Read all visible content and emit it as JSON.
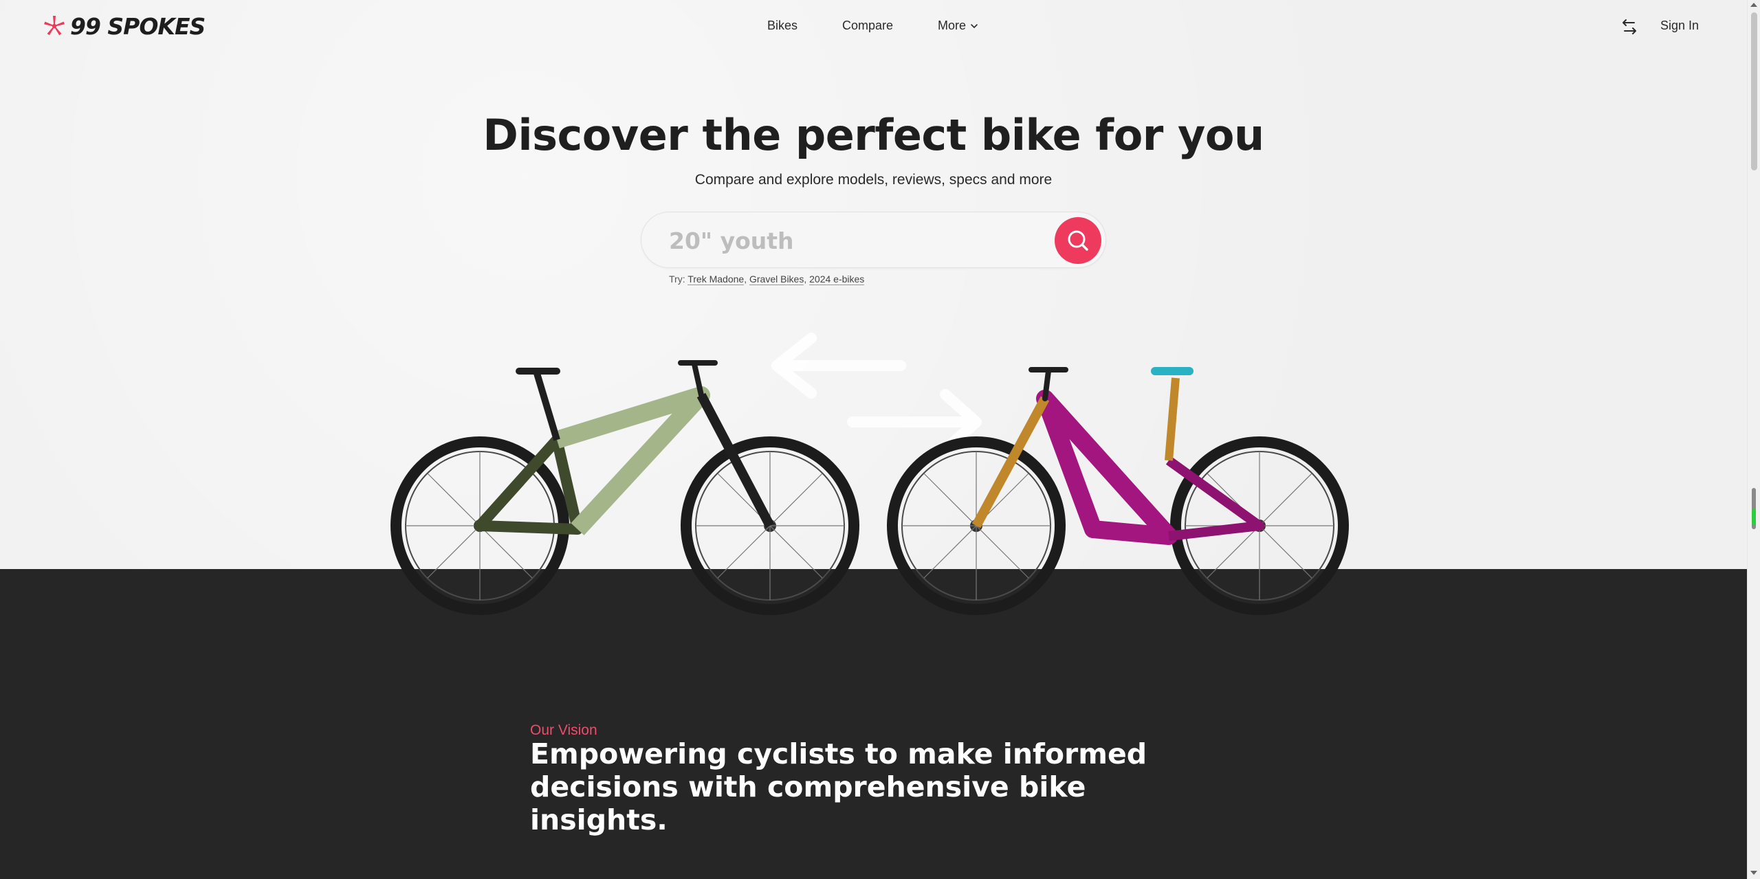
{
  "header": {
    "logo_text": "99 SPOKES",
    "nav": [
      {
        "label": "Bikes"
      },
      {
        "label": "Compare"
      },
      {
        "label": "More"
      }
    ],
    "sign_in": "Sign In"
  },
  "hero": {
    "title": "Discover the perfect bike for you",
    "subtitle": "Compare and explore models, reviews, specs and more",
    "search_placeholder": "20\" youth",
    "try_prefix": "Try:",
    "suggestions": [
      "Trek Madone",
      "Gravel Bikes",
      "2024 e-bikes"
    ]
  },
  "vision": {
    "label": "Our Vision",
    "title_line1": "Empowering cyclists to make informed",
    "title_line2": "decisions with comprehensive bike insights."
  },
  "colors": {
    "accent": "#ee3a5d",
    "dark_bg": "#262626",
    "page_bg": "#f0f0f0",
    "bike_left_frame": "#a4b58a",
    "bike_right_frame": "#a3157f"
  },
  "icons": {
    "logo": "spoke-star-icon",
    "more_chevron": "chevron-down-icon",
    "compare_swap": "swap-arrows-icon",
    "search": "search-icon"
  }
}
